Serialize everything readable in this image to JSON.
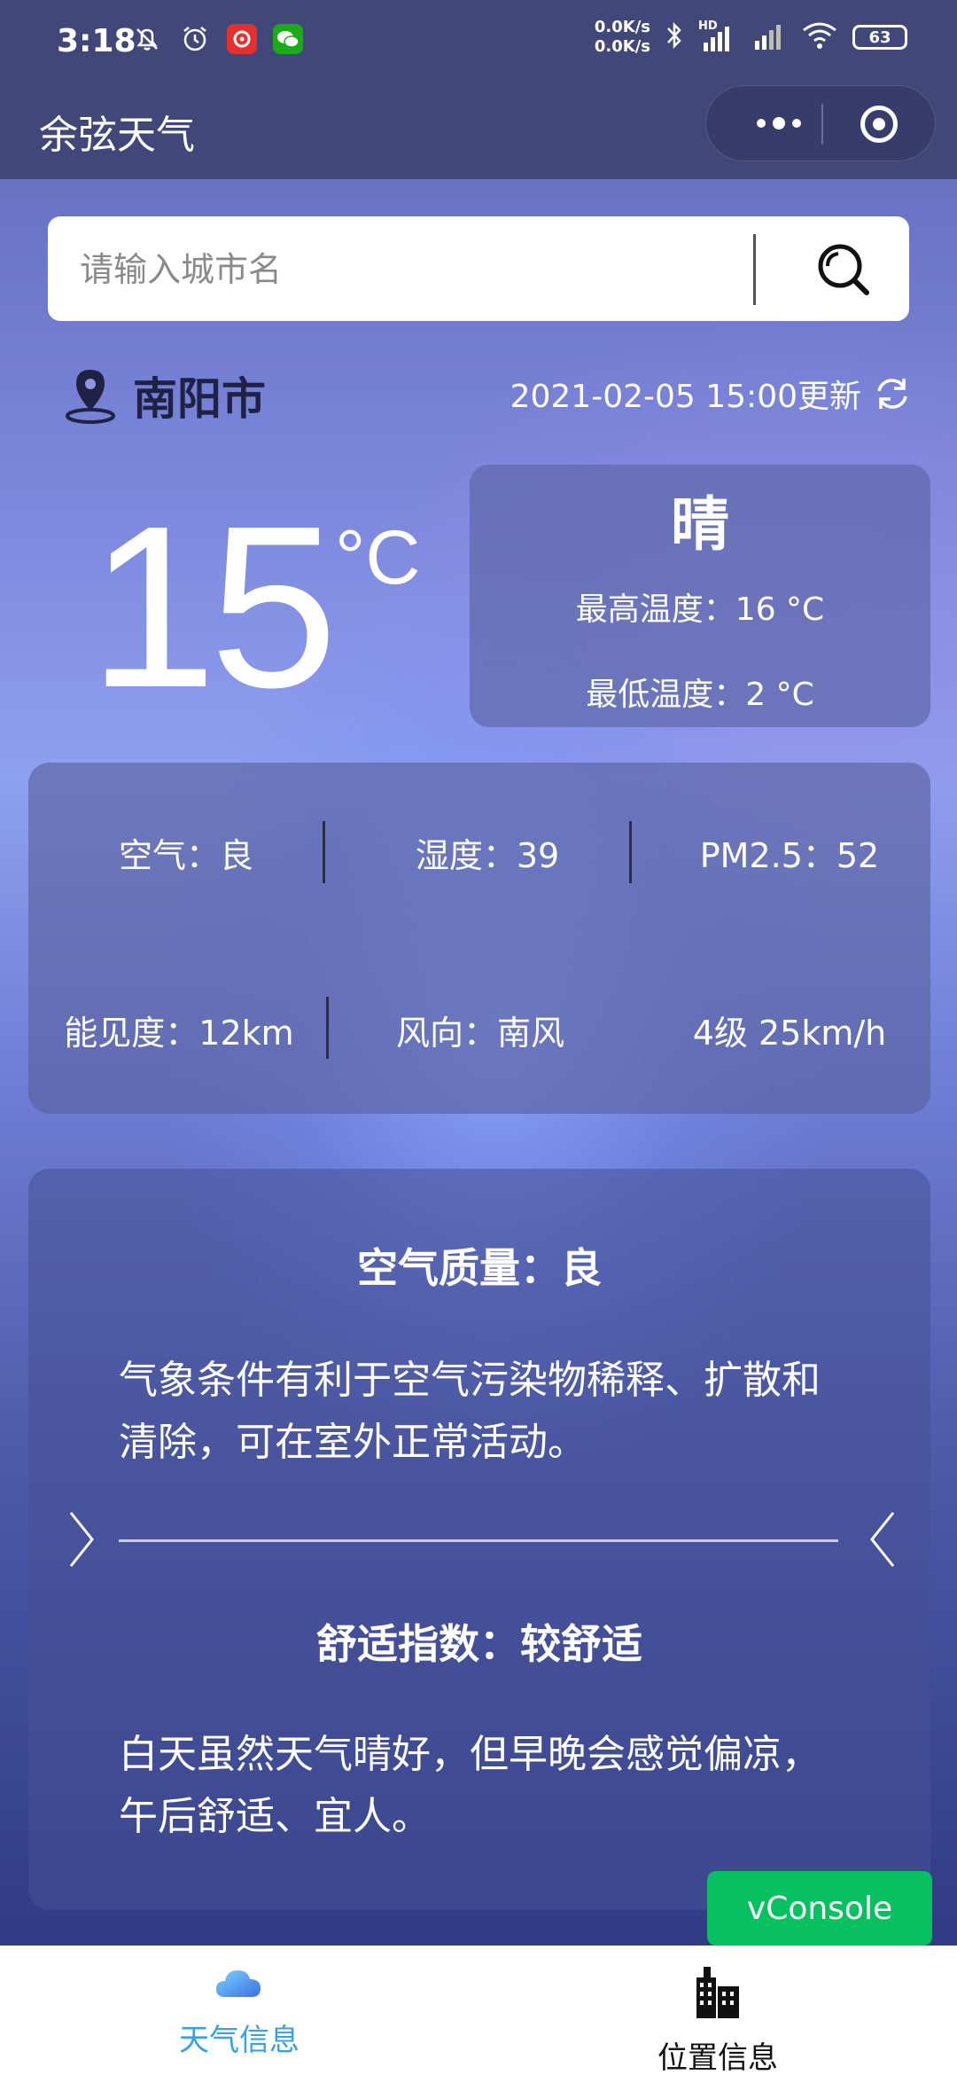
{
  "status_bar": {
    "time": "3:18",
    "net_up": "0.0K/s",
    "net_down": "0.0K/s",
    "signal_label": "HD",
    "battery": "63"
  },
  "navbar": {
    "title": "余弦天气"
  },
  "search": {
    "placeholder": "请输入城市名",
    "value": ""
  },
  "location": {
    "city": "南阳市",
    "updated": "2021-02-05 15:00更新"
  },
  "current": {
    "temperature": "15",
    "unit": "°C",
    "condition": "晴",
    "high": "最高温度：16 °C",
    "low": "最低温度：2 °C"
  },
  "details": {
    "air": "空气：良",
    "humidity": "湿度：39",
    "pm25": "PM2.5：52",
    "visibility": "能见度：12km",
    "wind_direction": "风向：南风",
    "wind_speed": "4级 25km/h"
  },
  "indices": [
    {
      "title": "空气质量：良",
      "text": "气象条件有利于空气污染物稀释、扩散和清除，可在室外正常活动。"
    },
    {
      "title": "舒适指数：较舒适",
      "text": "白天虽然天气晴好，但早晚会感觉偏凉，午后舒适、宜人。"
    }
  ],
  "vconsole": "vConsole",
  "tabbar": {
    "tabs": [
      {
        "label": "天气信息",
        "icon": "cloud-icon",
        "active": true
      },
      {
        "label": "位置信息",
        "icon": "buildings-icon",
        "active": false
      }
    ]
  },
  "colors": {
    "tab_active": "#3aa0e6",
    "tab_inactive": "#111111",
    "vconsole_bg": "#07c160",
    "bar_bg": "#42477a"
  }
}
